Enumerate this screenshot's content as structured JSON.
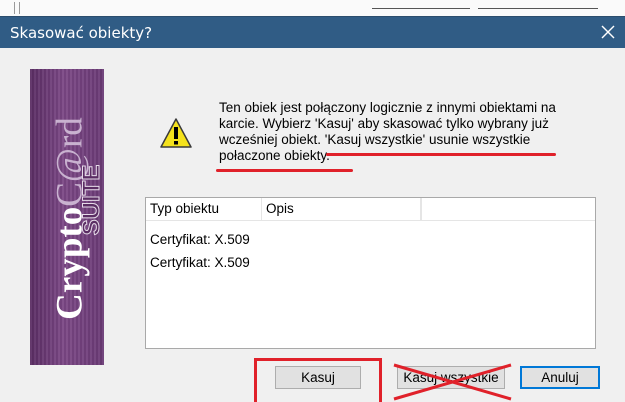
{
  "dialog": {
    "title": "Skasować obiekty?",
    "message_lines": [
      "Ten obiek jest połączony logicznie z innymi obiektami na",
      "karcie. Wybierz 'Kasuj' aby skasować tylko wybrany już",
      "wcześniej obiekt. 'Kasuj wszystkie' usunie wszystkie",
      "połaczone obiekty."
    ]
  },
  "banner": {
    "brand_word": "Crypto",
    "brand_card": "C@rd",
    "brand_suite": "SUITE"
  },
  "list": {
    "columns": [
      "Typ obiektu",
      "Opis"
    ],
    "rows": [
      {
        "type": "Certyfikat: X.509",
        "desc": ""
      },
      {
        "type": "Certyfikat: X.509",
        "desc": ""
      }
    ]
  },
  "buttons": {
    "delete": "Kasuj",
    "delete_all": "Kasuj wszystkie",
    "cancel": "Anuluj"
  },
  "colors": {
    "titlebar": "#305c85",
    "annotation_red": "#e0212a",
    "banner_purple": "#6a3a75",
    "focus_blue": "#0078d7"
  },
  "icons": {
    "warning": "warning-triangle-icon",
    "close": "close-icon"
  }
}
